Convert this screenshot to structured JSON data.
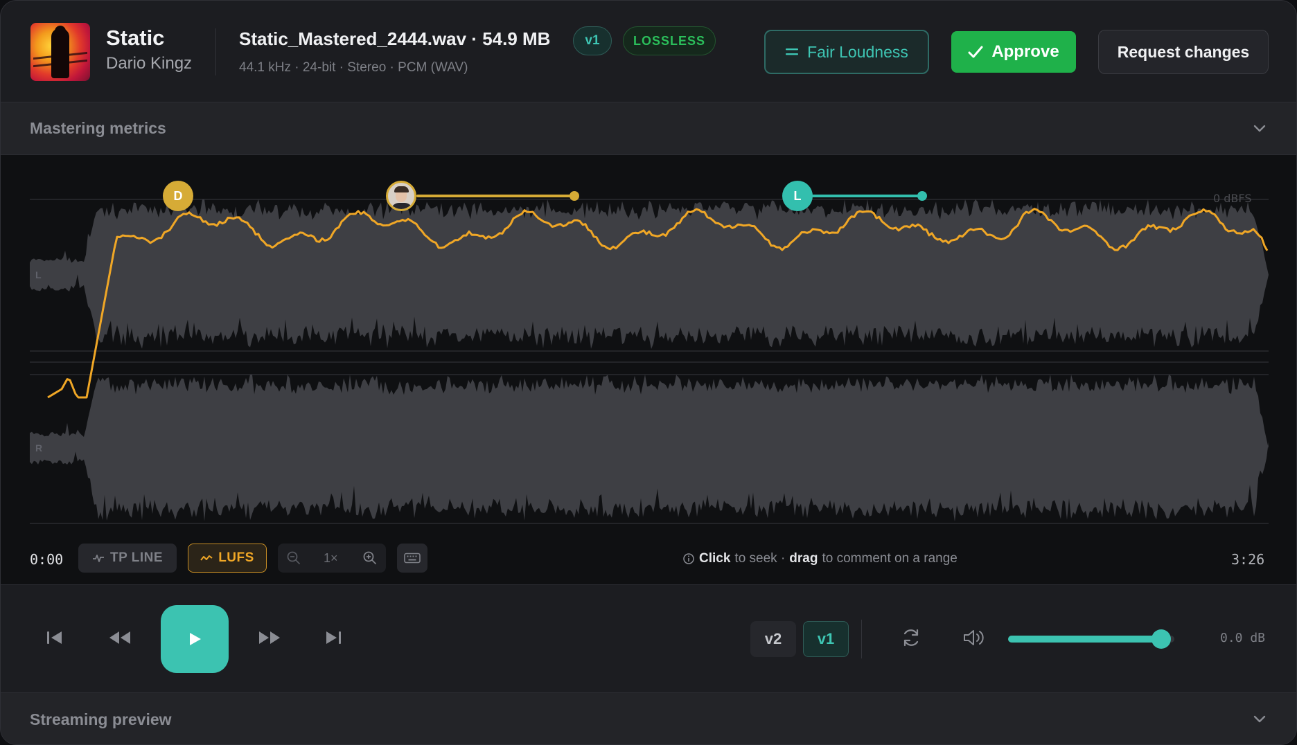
{
  "track": {
    "title": "Static",
    "artist": "Dario Kingz"
  },
  "file": {
    "name": "Static_Mastered_2444.wav · 54.9 MB",
    "meta": "44.1 kHz · 24-bit · Stereo · PCM (WAV)",
    "version_badge": "v1",
    "format_badge": "LOSSLESS"
  },
  "actions": {
    "fair_loudness": "Fair Loudness",
    "approve": "Approve",
    "request_changes": "Request changes"
  },
  "sections": {
    "mastering_metrics": "Mastering metrics",
    "streaming_preview": "Streaming preview"
  },
  "waveform": {
    "scale_label": "0 dBFS",
    "channel_left": "L",
    "channel_right": "R",
    "markers": [
      {
        "initial": "D",
        "color": "#d6ab36"
      },
      {
        "initial": "",
        "color": "#d6ab36",
        "type": "avatar"
      },
      {
        "initial": "L",
        "color": "#33bfae"
      }
    ],
    "time_start": "0:00",
    "time_end": "3:26",
    "hint": {
      "click": "Click",
      "seek": "to seek ·",
      "drag": "drag",
      "comment": "to comment on a range"
    }
  },
  "tools": {
    "tp_line": "TP LINE",
    "lufs": "LUFS",
    "zoom": "1×",
    "lufs_active": true,
    "tp_line_active": false
  },
  "transport": {
    "versions": [
      "v2",
      "v1"
    ],
    "active_version": "v1",
    "volume_db": "0.0 dB",
    "volume_level": 0.92
  },
  "colors": {
    "accent": "#3cc3b1",
    "approve": "#1fb14a",
    "lufs": "#f0a726",
    "marker_gold": "#d6ab36"
  }
}
